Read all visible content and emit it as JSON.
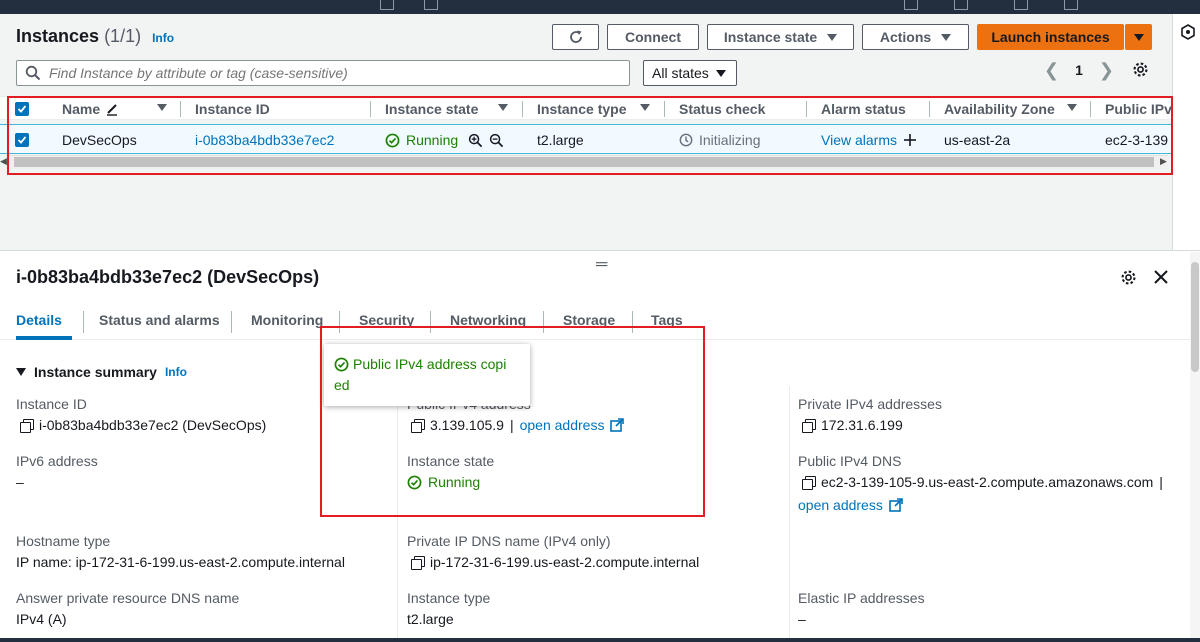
{
  "header": {
    "title": "Instances",
    "count": "(1/1)",
    "info": "Info",
    "buttons": {
      "refresh_icon": "refresh-icon",
      "connect": "Connect",
      "instance_state": "Instance state",
      "actions": "Actions",
      "launch": "Launch instances"
    }
  },
  "filter": {
    "placeholder": "Find Instance by attribute or tag (case-sensitive)",
    "state_select": "All states",
    "page": "1"
  },
  "table": {
    "columns": [
      "Name",
      "Instance ID",
      "Instance state",
      "Instance type",
      "Status check",
      "Alarm status",
      "Availability Zone",
      "Public IPv"
    ],
    "row": {
      "name": "DevSecOps",
      "instance_id": "i-0b83ba4bdb33e7ec2",
      "state": "Running",
      "type": "t2.large",
      "status_check": "Initializing",
      "alarm": "View alarms",
      "az": "us-east-2a",
      "public": "ec2-3-139"
    }
  },
  "details": {
    "title": "i-0b83ba4bdb33e7ec2 (DevSecOps)",
    "tabs": [
      "Details",
      "Status and alarms",
      "Monitoring",
      "Security",
      "Networking",
      "Storage",
      "Tags"
    ],
    "section": "Instance summary",
    "section_info": "Info",
    "fields": {
      "instance_id_label": "Instance ID",
      "instance_id_value": "i-0b83ba4bdb33e7ec2 (DevSecOps)",
      "ipv6_label": "IPv6 address",
      "ipv6_value": "–",
      "hostname_label": "Hostname type",
      "hostname_value": "IP name: ip-172-31-6-199.us-east-2.compute.internal",
      "answer_label": "Answer private resource DNS name",
      "answer_value": "IPv4 (A)",
      "public_ipv4_label": "Public IPv4 address",
      "public_ipv4_value": "3.139.105.9",
      "open_address": "open address",
      "instance_state_label": "Instance state",
      "instance_state_value": "Running",
      "private_dns_label": "Private IP DNS name (IPv4 only)",
      "private_dns_value": "ip-172-31-6-199.us-east-2.compute.internal",
      "instance_type_label": "Instance type",
      "instance_type_value": "t2.large",
      "private_ipv4_label": "Private IPv4 addresses",
      "private_ipv4_value": "172.31.6.199",
      "public_dns_label": "Public IPv4 DNS",
      "public_dns_value": "ec2-3-139-105-9.us-east-2.compute.amazonaws.com",
      "public_dns_open": "open address",
      "elastic_label": "Elastic IP addresses",
      "elastic_value": "–"
    },
    "tooltip_line1": "Public IPv4 address copi",
    "tooltip_line2": "ed"
  },
  "colors": {
    "accent": "#0073bb",
    "primary_button": "#ec7211",
    "success": "#1d8102",
    "highlight_box": "#e31b23"
  }
}
